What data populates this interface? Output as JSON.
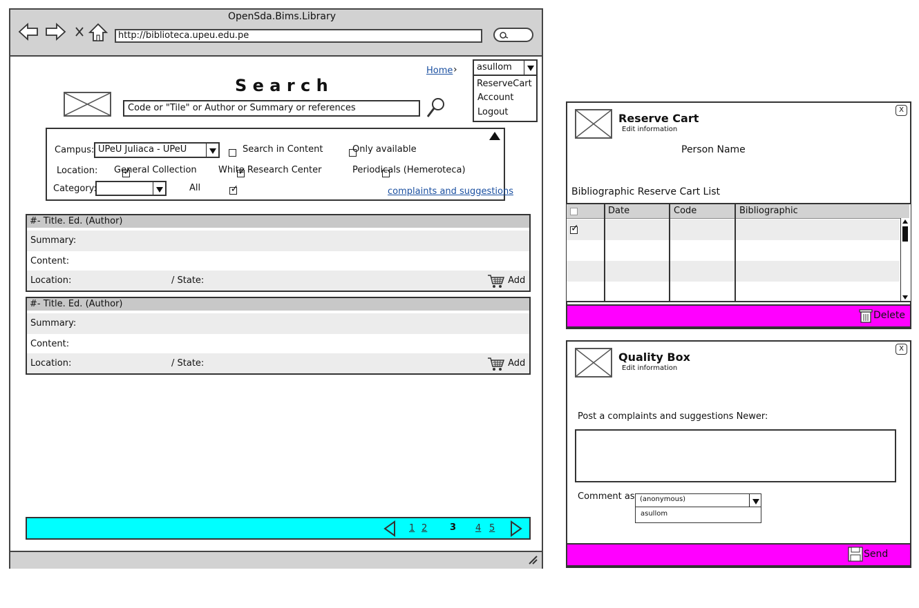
{
  "browser": {
    "title": "OpenSda.Bims.Library",
    "url": "http://biblioteca.upeu.edu.pe"
  },
  "nav": {
    "home": "Home",
    "user": "asullom",
    "menu": [
      "ReserveCart",
      "Account",
      "Logout"
    ]
  },
  "search": {
    "title": "S e a r c h",
    "placeholder": "Code or \"Tile\" or Author or Summary or references"
  },
  "filters": {
    "campus_label": "Campus:",
    "campus_value": "UPeU Juliaca - UPeU",
    "search_in_content": "Search in Content",
    "only_available": "Only available",
    "location_label": "Location:",
    "general_collection": "General Collection",
    "white_research": "White Research Center",
    "periodicals": "Periodicals (Hemeroteca)",
    "category_label": "Category:",
    "all": "All",
    "complaints_link": "complaints and suggestions"
  },
  "results": [
    {
      "title": "#- Title. Ed. (Author)",
      "summary": "Summary:",
      "content": "Content:",
      "location": "Location:",
      "state": "/ State:",
      "add": "Add"
    },
    {
      "title": "#- Title. Ed. (Author)",
      "summary": "Summary:",
      "content": "Content:",
      "location": "Location:",
      "state": "/ State:",
      "add": "Add"
    }
  ],
  "pagination": {
    "pages": [
      "1",
      "2",
      "3",
      "4",
      "5"
    ],
    "current": "3"
  },
  "reserve": {
    "title": "Reserve Cart",
    "subtitle": "Edit information",
    "close": "X",
    "person": "Person Name",
    "list_title": "Bibliographic Reserve Cart List",
    "columns": [
      "Date",
      "Code",
      "Bibliographic"
    ],
    "delete": "Delete"
  },
  "quality": {
    "title": "Quality Box",
    "subtitle": "Edit information",
    "close": "X",
    "prompt": "Post a complaints and suggestions Newer:",
    "comment_label": "Comment as:",
    "comment_value": "(anonymous)",
    "comment_option": "asullom",
    "send": "Send"
  },
  "colors": {
    "magenta": "#ff00ff",
    "cyan": "#00ffff",
    "chrome": "#d2d2d2",
    "link": "#1a4fa0"
  }
}
